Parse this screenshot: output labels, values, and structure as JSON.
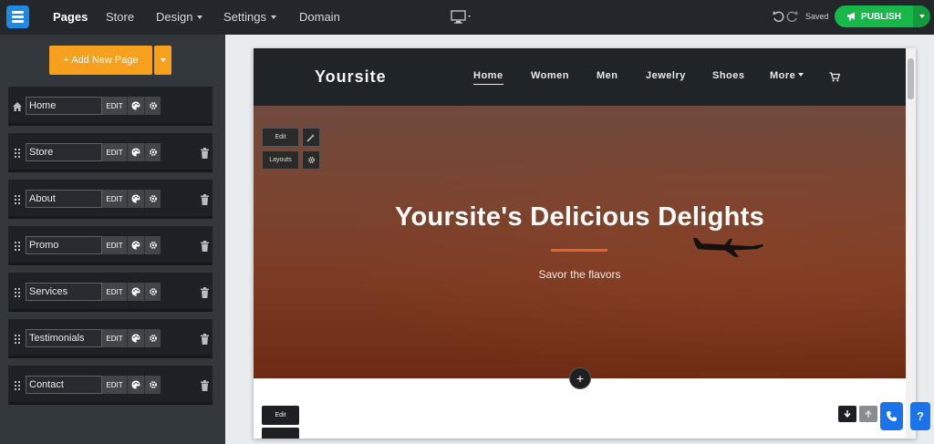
{
  "topbar": {
    "nav": [
      {
        "label": "Pages"
      },
      {
        "label": "Store"
      },
      {
        "label": "Design"
      },
      {
        "label": "Settings"
      },
      {
        "label": "Domain"
      }
    ],
    "saved_label": "Saved",
    "publish_label": "PUBLISH",
    "icons": {
      "logo": "app-logo-icon",
      "device": "desktop-icon",
      "undo": "undo-icon",
      "redo": "redo-icon",
      "publish": "megaphone-icon"
    },
    "colors": {
      "bar": "#23272b",
      "publish": "#16b84a"
    }
  },
  "sidebar": {
    "add_page_label": "+ Add New Page",
    "edit_label": "EDIT",
    "pages": [
      {
        "name": "Home"
      },
      {
        "name": "Store"
      },
      {
        "name": "About"
      },
      {
        "name": "Promo"
      },
      {
        "name": "Services"
      },
      {
        "name": "Testimonials"
      },
      {
        "name": "Contact"
      }
    ],
    "colors": {
      "add_button": "#f7a01e"
    }
  },
  "preview": {
    "site_logo": "Yoursite",
    "nav": [
      {
        "label": "Home"
      },
      {
        "label": "Women"
      },
      {
        "label": "Men"
      },
      {
        "label": "Jewelry"
      },
      {
        "label": "Shoes"
      },
      {
        "label": "More"
      }
    ],
    "hero": {
      "edit_label": "Edit",
      "layouts_label": "Layouts",
      "title": "Yoursite's Delicious Delights",
      "subtitle": "Savor the flavors",
      "accent_color": "#e8622c"
    },
    "add_section_label": "+",
    "below_edit_label": "Edit"
  },
  "floating": {
    "help_label": "?",
    "call_icon": "phone-icon"
  }
}
